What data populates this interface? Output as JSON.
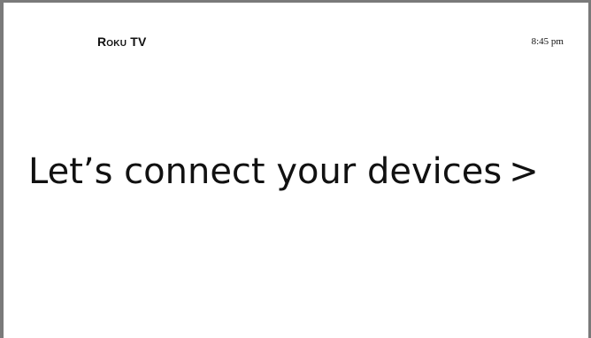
{
  "header": {
    "brand": "Roku TV",
    "time": "8:45 pm"
  },
  "main": {
    "headline": "Let’s connect your devices",
    "chevron": ">"
  },
  "colors": {
    "background": "#ffffff",
    "frame": "#7a7a7a",
    "text": "#111111"
  }
}
